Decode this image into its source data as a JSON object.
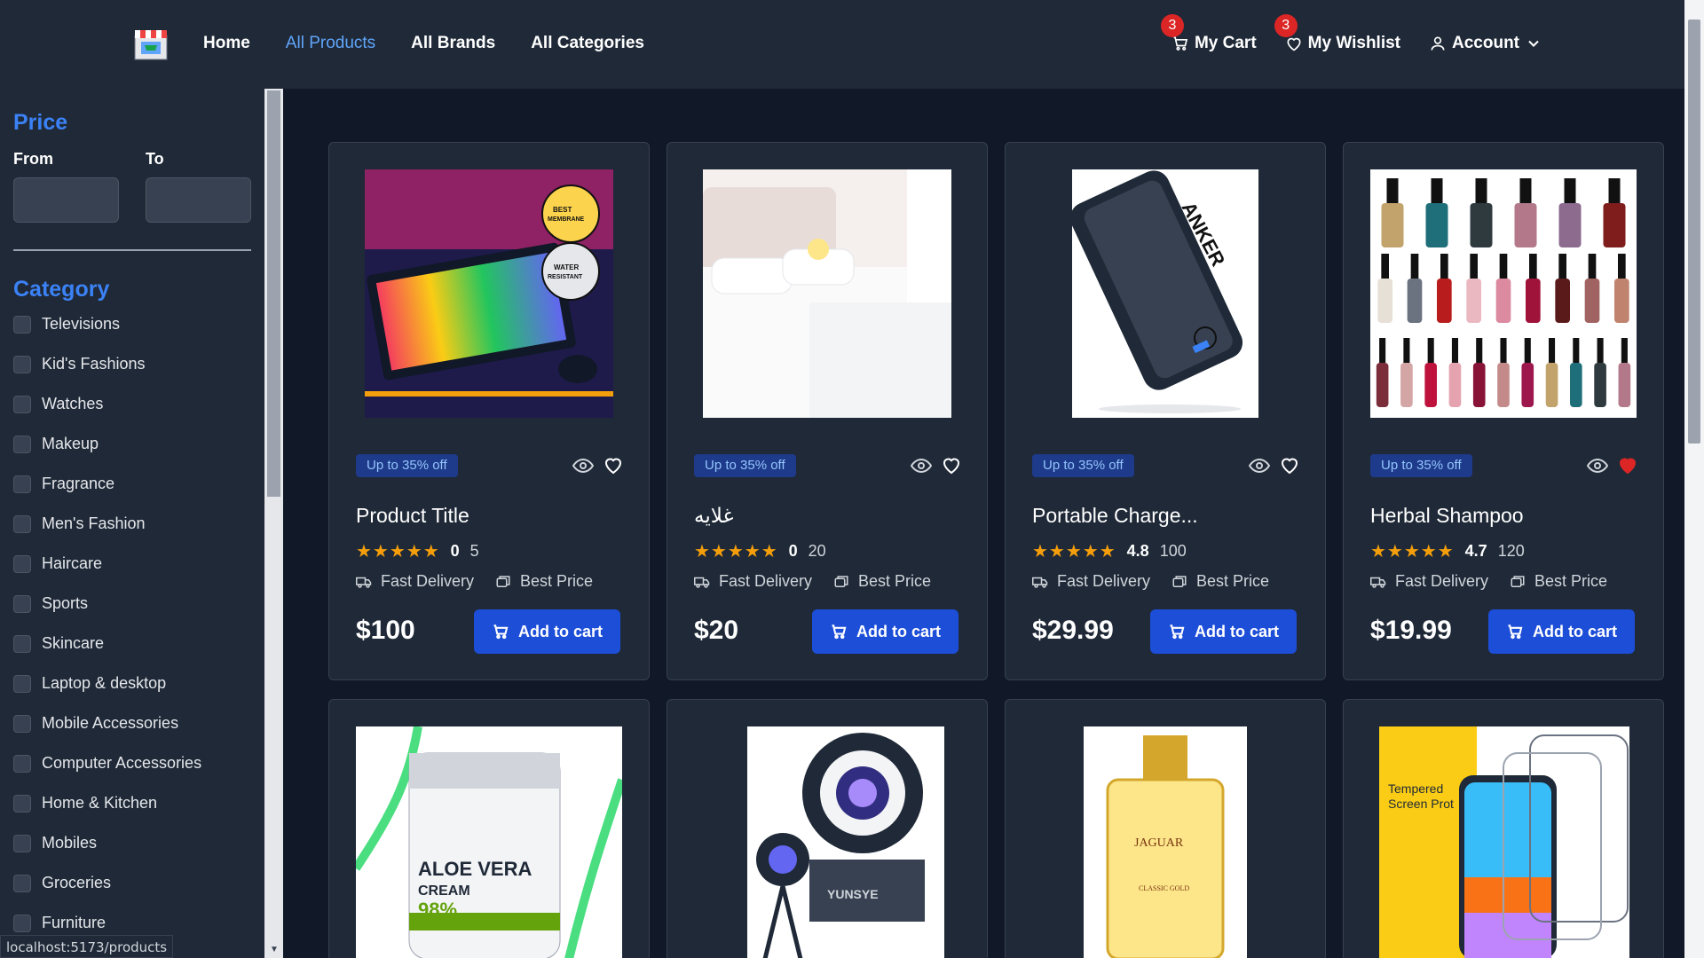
{
  "nav": {
    "links": [
      "Home",
      "All Products",
      "All Brands",
      "All Categories"
    ],
    "cart_label": "My Cart",
    "cart_count": "3",
    "wishlist_label": "My Wishlist",
    "wishlist_count": "3",
    "account_label": "Account"
  },
  "sidebar": {
    "price_title": "Price",
    "from_label": "From",
    "to_label": "To",
    "category_title": "Category",
    "categories": [
      "Televisions",
      "Kid's Fashions",
      "Watches",
      "Makeup",
      "Fragrance",
      "Men's Fashion",
      "Haircare",
      "Sports",
      "Skincare",
      "Laptop & desktop",
      "Mobile Accessories",
      "Computer Accessories",
      "Home & Kitchen",
      "Mobiles",
      "Groceries",
      "Furniture"
    ]
  },
  "status_url": "localhost:5173/products",
  "products": [
    {
      "title": "Product Title",
      "rating": "0",
      "count": "5",
      "price": "$100",
      "discount": "Up to 35% off",
      "wishlisted": false
    },
    {
      "title": "غلايه",
      "rating": "0",
      "count": "20",
      "price": "$20",
      "discount": "Up to 35% off",
      "wishlisted": false
    },
    {
      "title": "Portable Charge...",
      "rating": "4.8",
      "count": "100",
      "price": "$29.99",
      "discount": "Up to 35% off",
      "wishlisted": false
    },
    {
      "title": "Herbal Shampoo",
      "rating": "4.7",
      "count": "120",
      "price": "$19.99",
      "discount": "Up to 35% off",
      "wishlisted": true
    }
  ],
  "card_labels": {
    "fast_delivery": "Fast Delivery",
    "best_price": "Best Price",
    "add_to_cart": "Add to cart"
  },
  "colors": {
    "accent": "#1d4ed8",
    "wishlist_active": "#dc2626",
    "star": "#f59e0b"
  }
}
